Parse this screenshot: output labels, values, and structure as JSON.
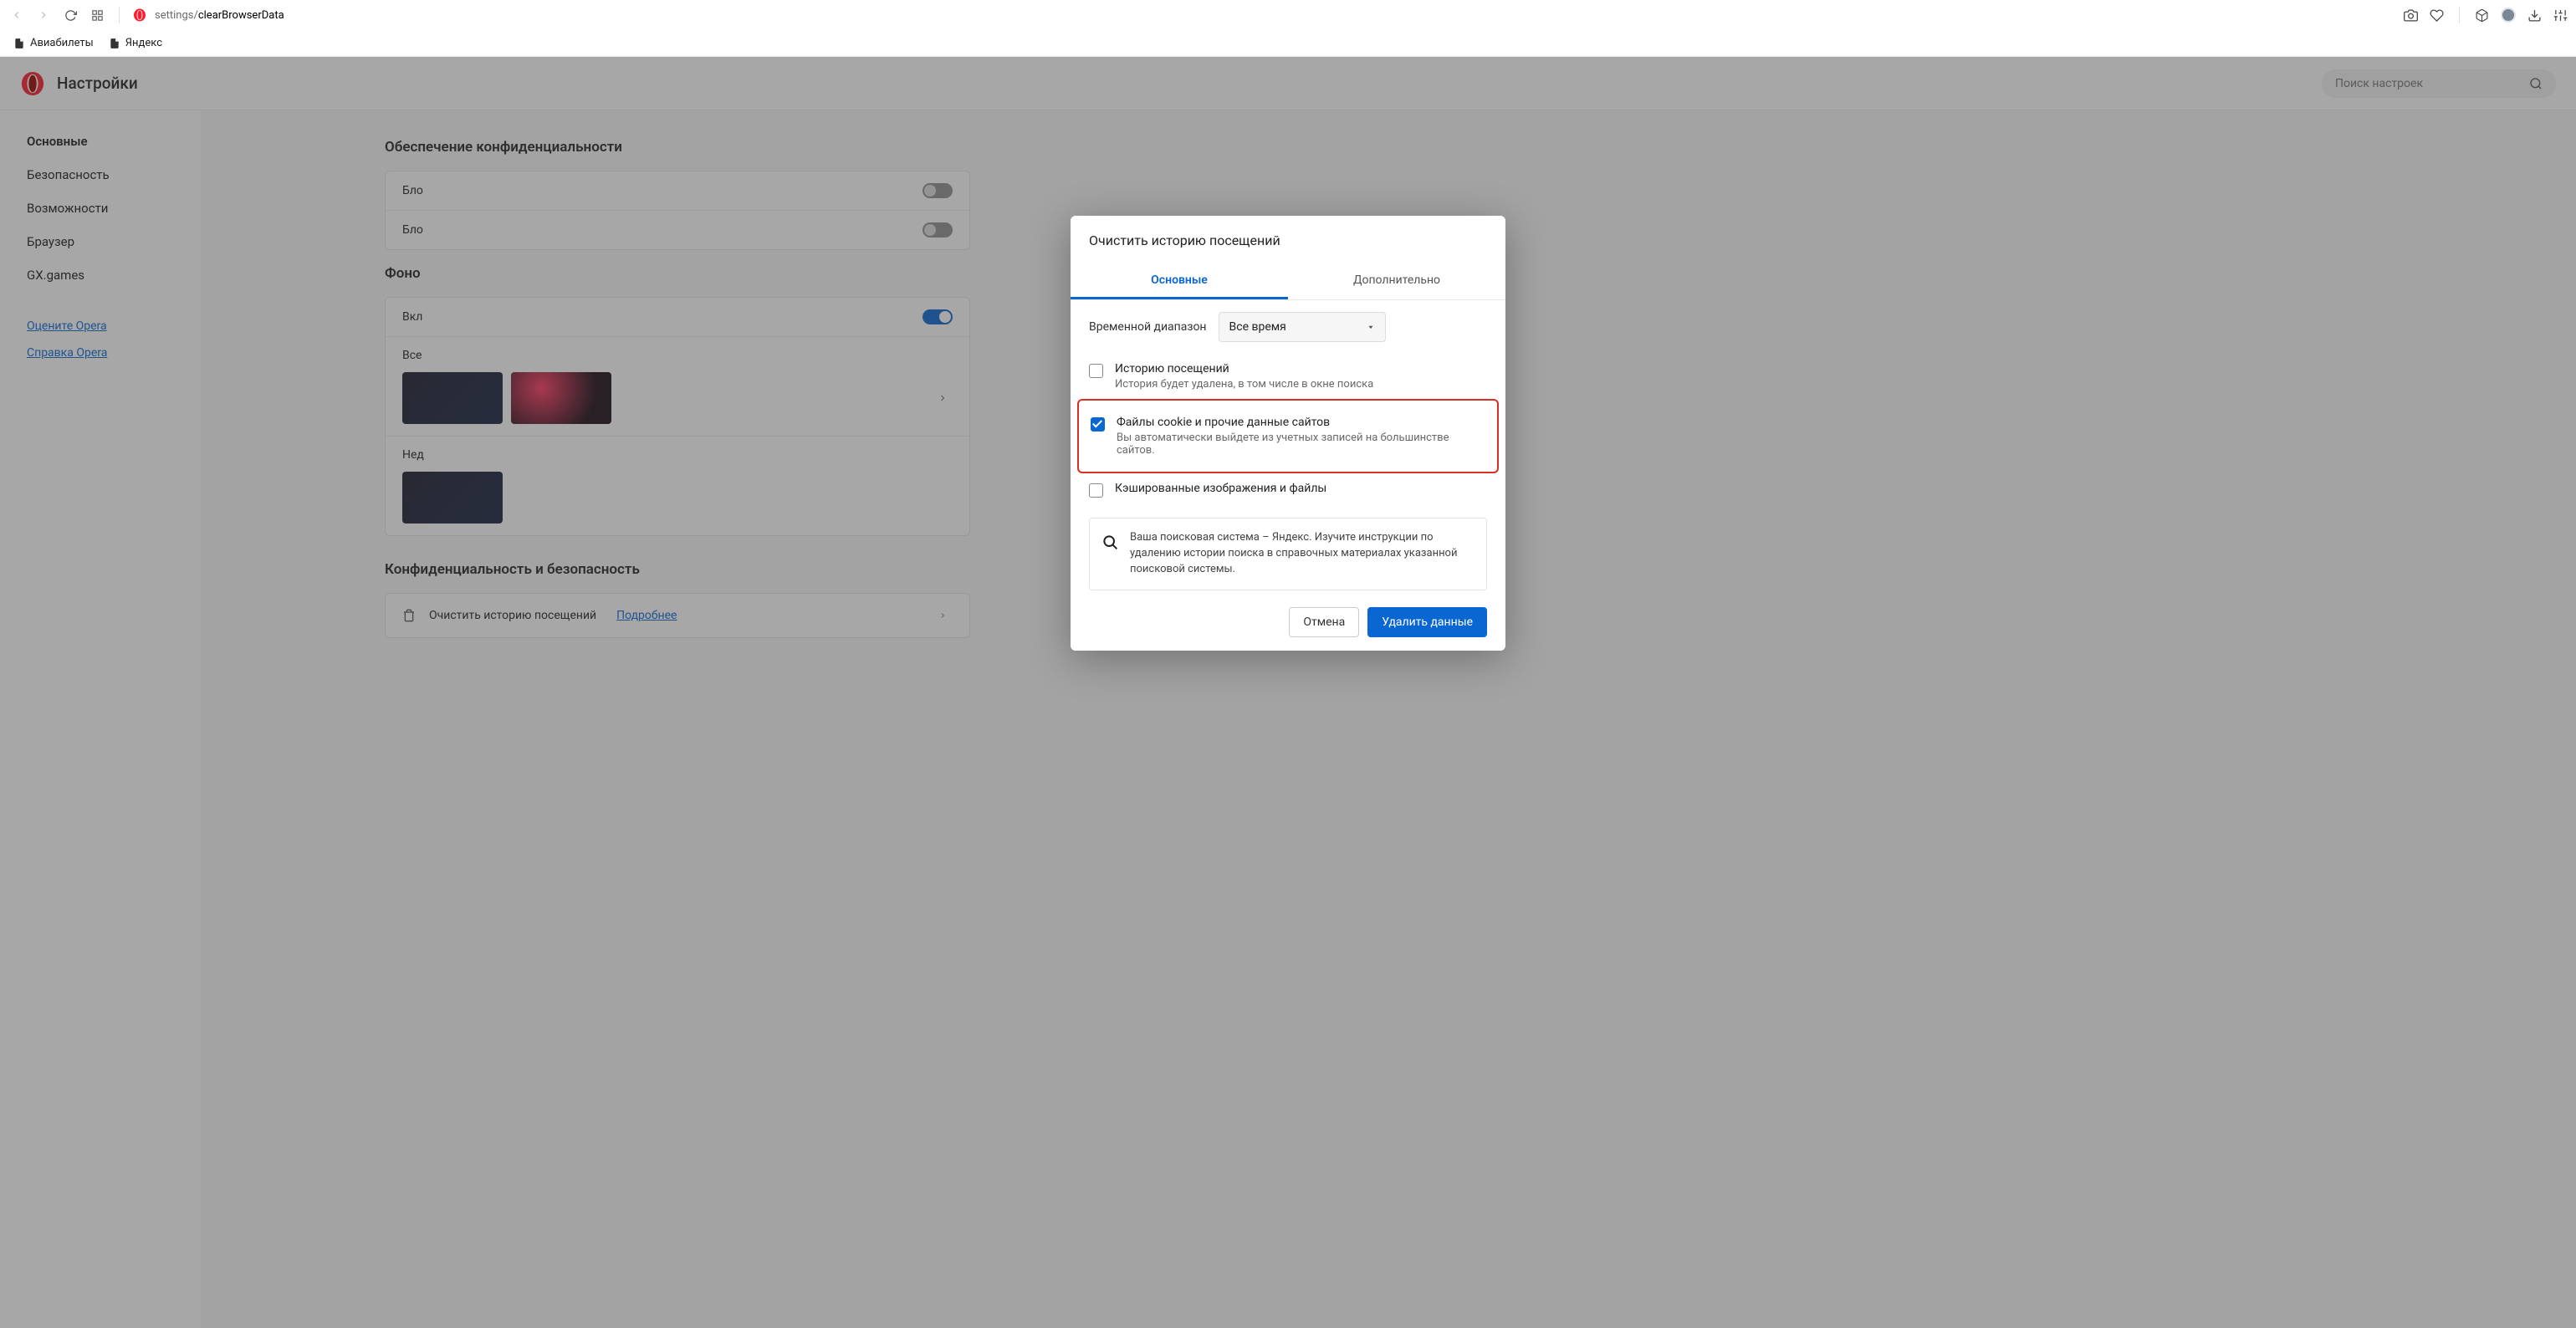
{
  "toolbar": {
    "url_prefix": "settings/",
    "url_active": "clearBrowserData"
  },
  "bookmarks": [
    {
      "label": "Авиабилеты"
    },
    {
      "label": "Яндекс"
    }
  ],
  "header": {
    "title": "Настройки",
    "search_placeholder": "Поиск настроек"
  },
  "sidebar": {
    "items": [
      {
        "label": "Основные",
        "active": true
      },
      {
        "label": "Безопасность"
      },
      {
        "label": "Возможности"
      },
      {
        "label": "Браузер"
      },
      {
        "label": "GX.games"
      }
    ],
    "links": [
      {
        "label": "Оцените Opera"
      },
      {
        "label": "Справка Opera"
      }
    ]
  },
  "sections": {
    "privacy_heading": "Обеспечение конфиденциальности",
    "row_block1": "Бло",
    "row_block2": "Бло",
    "wallpaper_heading": "Фоно",
    "wallpaper_enable": "Вкл",
    "wallpaper_all": "Все",
    "wallpaper_recent": "Нед",
    "security_heading": "Конфиденциальность и безопасность",
    "clear_history_label": "Очистить историю посещений",
    "clear_history_link": "Подробнее"
  },
  "modal": {
    "title": "Очистить историю посещений",
    "tabs": {
      "basic": "Основные",
      "advanced": "Дополнительно"
    },
    "time_range_label": "Временной диапазон",
    "time_range_value": "Все время",
    "items": [
      {
        "title": "Историю посещений",
        "sub": "История будет удалена, в том числе в окне поиска",
        "checked": false
      },
      {
        "title": "Файлы cookie и прочие данные сайтов",
        "sub": "Вы автоматически выйдете из учетных записей на большинстве сайтов.",
        "checked": true,
        "highlight": true
      },
      {
        "title": "Кэшированные изображения и файлы",
        "sub": "",
        "checked": false
      }
    ],
    "info": "Ваша поисковая система – Яндекс. Изучите инструкции по удалению истории поиска в справочных материалах указанной поисковой системы.",
    "cancel": "Отмена",
    "confirm": "Удалить данные"
  }
}
